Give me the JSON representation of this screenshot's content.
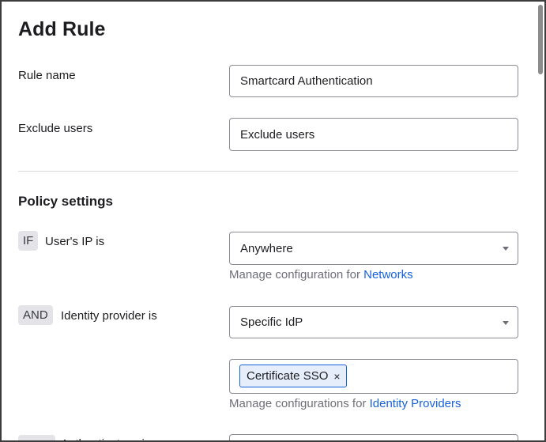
{
  "dialog": {
    "title": "Add Rule"
  },
  "fields": {
    "rule_name": {
      "label": "Rule name",
      "value": "Smartcard Authentication"
    },
    "exclude_users": {
      "label": "Exclude users",
      "placeholder": "Exclude users"
    }
  },
  "policy": {
    "heading": "Policy settings",
    "ip": {
      "badge": "IF",
      "label": "User's IP is",
      "value": "Anywhere",
      "help_prefix": "Manage configuration for ",
      "help_link": "Networks"
    },
    "idp": {
      "badge": "AND",
      "label": "Identity provider is",
      "value": "Specific IdP",
      "chip": "Certificate SSO",
      "chip_remove": "×",
      "help_prefix": "Manage configurations for ",
      "help_link": "Identity Providers"
    },
    "next": {
      "badge": "AND",
      "label": "Authenticates via"
    }
  },
  "colors": {
    "link": "#1662dd",
    "chip_border": "#1662dd",
    "chip_bg": "#e6eefc",
    "badge_bg": "#e3e3e8"
  }
}
